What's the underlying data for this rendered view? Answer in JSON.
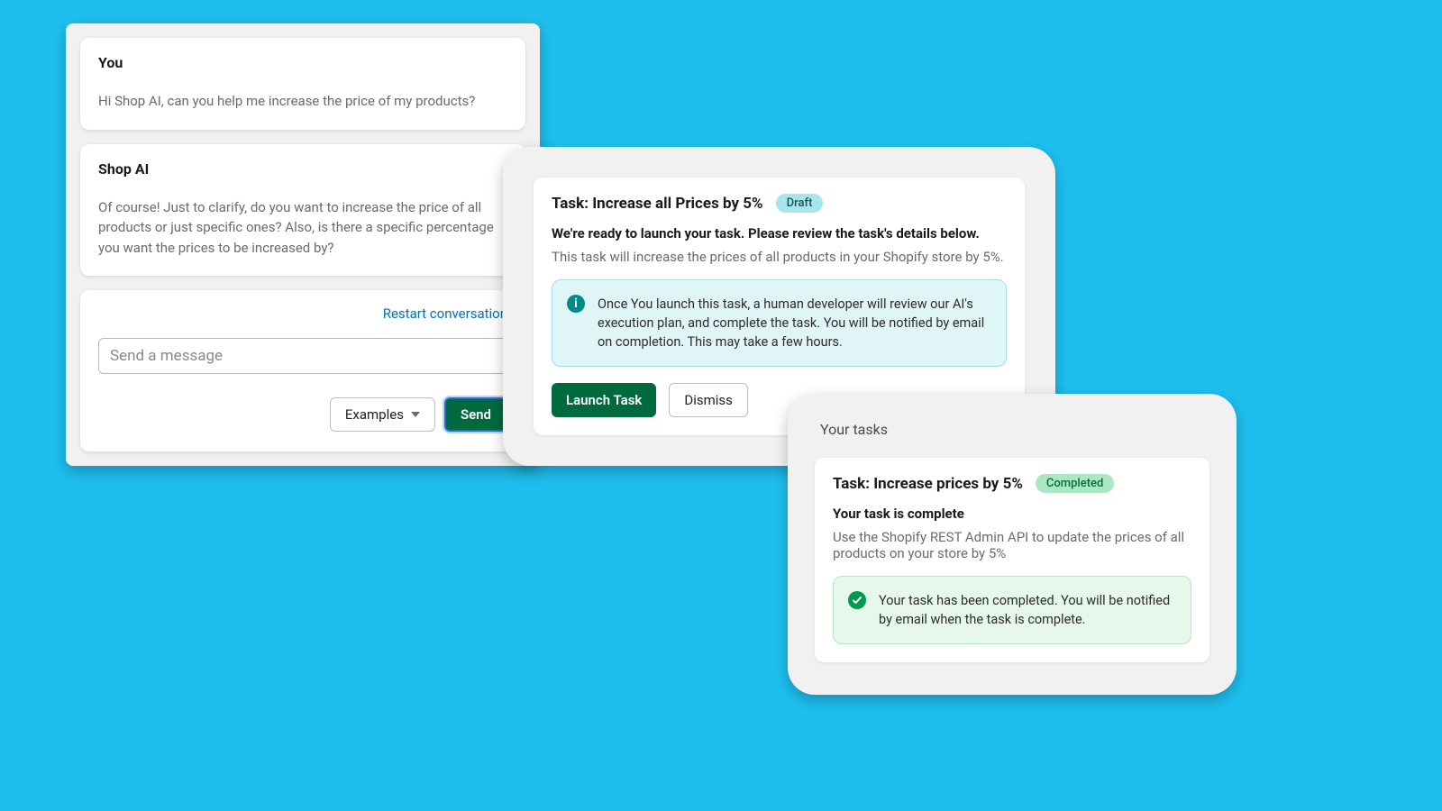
{
  "chat": {
    "user_label": "You",
    "user_msg": "Hi Shop AI, can you help me increase the price of my products?",
    "ai_label": "Shop AI",
    "ai_msg": "Of course! Just to clarify, do you want to increase the price of all products or just specific ones? Also, is there a specific percentage you want the prices to be increased by?",
    "restart_label": "Restart conversation",
    "input_placeholder": "Send a message",
    "examples_label": "Examples",
    "send_label": "Send"
  },
  "review": {
    "title": "Task: Increase all Prices by 5%",
    "badge": "Draft",
    "ready": "We're ready to launch your task. Please review the task's details below.",
    "desc": "This task will increase the prices of all products in your Shopify store by 5%.",
    "info": "Once You launch this task, a human developer will review our AI's execution plan, and complete the task. You will be notified by email on completion. This may take a few hours.",
    "launch_label": "Launch Task",
    "dismiss_label": "Dismiss"
  },
  "done": {
    "header": "Your tasks",
    "title": "Task: Increase prices by 5%",
    "badge": "Completed",
    "complete": "Your task is complete",
    "desc": "Use the Shopify REST Admin API to update the prices of all products on your store by 5%",
    "success": "Your task has been completed. You will be notified by email when the task is complete."
  }
}
